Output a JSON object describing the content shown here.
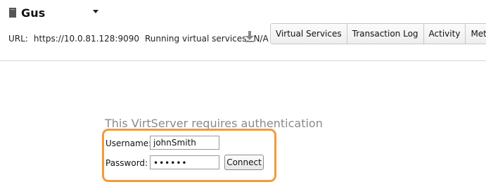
{
  "header": {
    "server_name": "Gus",
    "server_icon": "server-icon",
    "dropdown_icon": "chevron-down-icon"
  },
  "info": {
    "url_label": "URL:",
    "url_value": "https://10.0.81.128:9090",
    "running_label": "Running virtual services:",
    "running_value": "N/A",
    "download_icon": "download-icon"
  },
  "tabs": [
    {
      "label": "Virtual Services"
    },
    {
      "label": "Transaction Log"
    },
    {
      "label": "Activity"
    },
    {
      "label": "Metrics"
    }
  ],
  "auth": {
    "title": "This VirtServer requires authentication",
    "username_label": "Username:",
    "username_value": "johnSmith",
    "password_label": "Password:",
    "password_value": "••••••",
    "connect_label": "Connect",
    "highlight_color": "#f39a3a"
  }
}
